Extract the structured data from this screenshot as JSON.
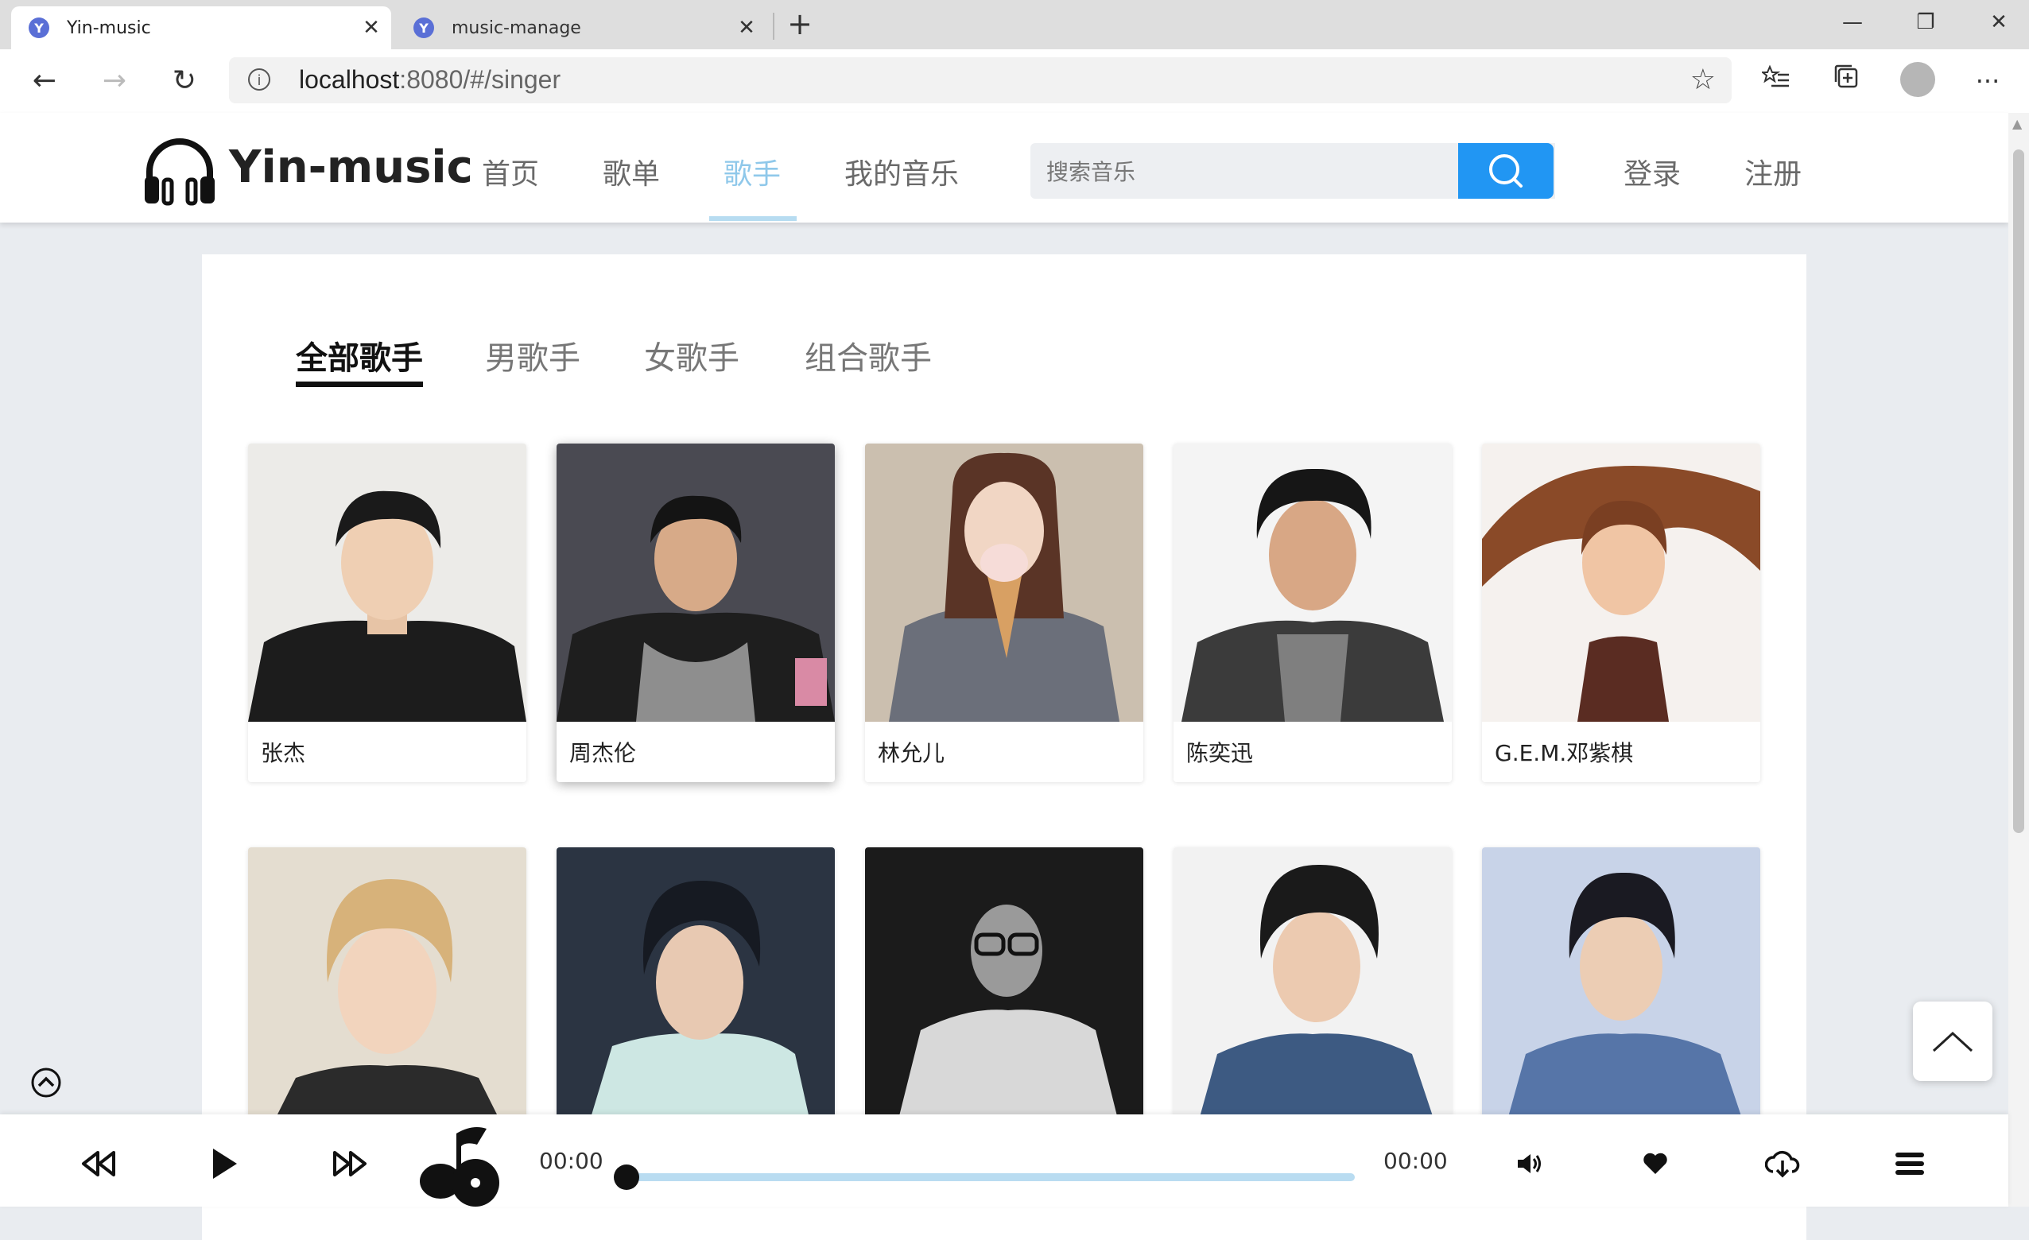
{
  "browser": {
    "tabs": [
      {
        "title": "Yin-music",
        "active": true
      },
      {
        "title": "music-manage",
        "active": false
      }
    ],
    "url_host": "localhost",
    "url_rest": ":8080/#/singer"
  },
  "header": {
    "brand": "Yin-music",
    "nav": [
      "首页",
      "歌单",
      "歌手",
      "我的音乐"
    ],
    "active_nav": "歌手",
    "search_placeholder": "搜索音乐",
    "login": "登录",
    "register": "注册"
  },
  "filters": {
    "tabs": [
      "全部歌手",
      "男歌手",
      "女歌手",
      "组合歌手"
    ],
    "active": "全部歌手"
  },
  "singers": [
    {
      "name": "张杰"
    },
    {
      "name": "周杰伦"
    },
    {
      "name": "林允儿"
    },
    {
      "name": "陈奕迅"
    },
    {
      "name": "G.E.M.邓紫棋"
    },
    {
      "name": ""
    },
    {
      "name": ""
    },
    {
      "name": ""
    },
    {
      "name": ""
    },
    {
      "name": ""
    }
  ],
  "player": {
    "current_time": "00:00",
    "total_time": "00:00",
    "progress": 0
  },
  "colors": {
    "accent": "#2196f3",
    "nav_active": "#8fc8ea",
    "progress_track": "#b9dcf1"
  }
}
